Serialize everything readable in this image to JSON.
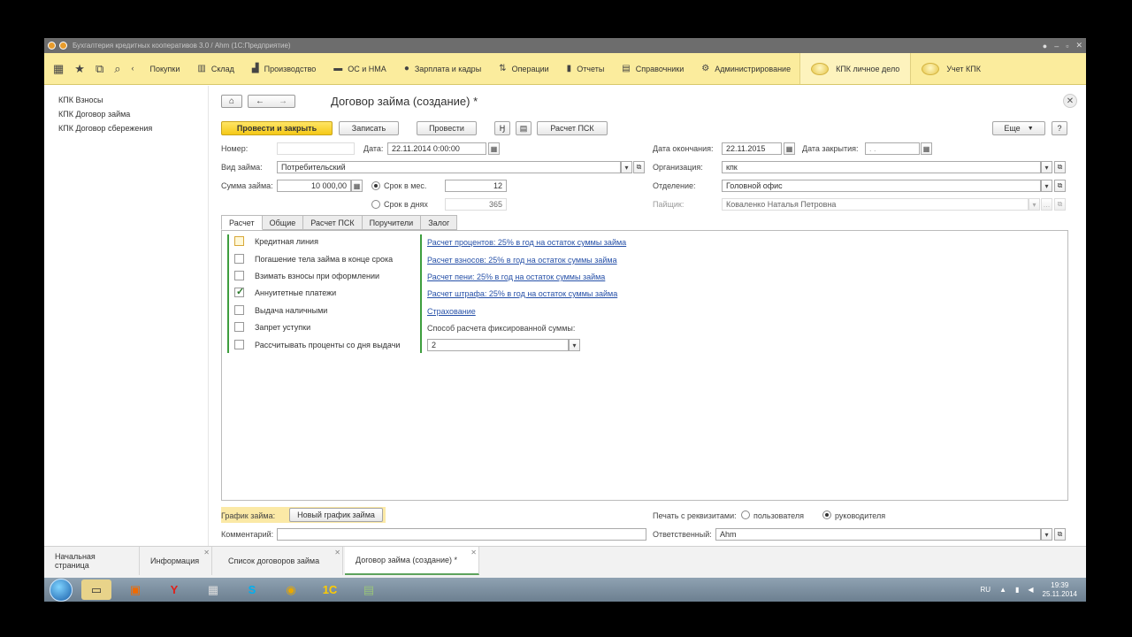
{
  "window": {
    "title": "Бухгалтерия кредитных кооперативов 3.0 / Ahm (1С:Предприятие)"
  },
  "sections": {
    "items": [
      {
        "label": "Покупки",
        "icon": "cart-icon"
      },
      {
        "label": "Склад",
        "icon": "warehouse-icon"
      },
      {
        "label": "Производство",
        "icon": "factory-icon"
      },
      {
        "label": "ОС и НМА",
        "icon": "truck-icon"
      },
      {
        "label": "Зарплата и кадры",
        "icon": "person-icon"
      },
      {
        "label": "Операции",
        "icon": "operations-icon"
      },
      {
        "label": "Отчеты",
        "icon": "chart-icon"
      },
      {
        "label": "Справочники",
        "icon": "book-icon"
      },
      {
        "label": "Администрирование",
        "icon": "gear-icon"
      }
    ],
    "extra": [
      "КПК личное дело",
      "Учет КПК"
    ]
  },
  "left_nav": [
    "КПК Взносы",
    "КПК Договор займа",
    "КПК Договор сбережения"
  ],
  "form": {
    "title": "Договор займа (создание) *",
    "buttons": {
      "post_close": "Провести и закрыть",
      "save": "Записать",
      "post": "Провести",
      "psk": "Расчет ПСК",
      "more": "Еще",
      "help": "?"
    },
    "fields": {
      "number_label": "Номер:",
      "number_value": "",
      "date_label": "Дата:",
      "date_value": "22.11.2014  0:00:00",
      "end_date_label": "Дата окончания:",
      "end_date_value": "22.11.2015",
      "close_date_label": "Дата закрытия:",
      "close_date_value": " .  .",
      "loan_type_label": "Вид займа:",
      "loan_type_value": "Потребительский",
      "org_label": "Организация:",
      "org_value": "кпк",
      "amount_label": "Сумма займа:",
      "amount_value": "10 000,00",
      "term_months_label": "Срок в мес.",
      "term_months_value": "12",
      "term_days_label": "Срок в днях",
      "term_days_value": "365",
      "branch_label": "Отделение:",
      "branch_value": "Головной офис",
      "member_label": "Пайщик:",
      "member_value": "Коваленко Наталья Петровна"
    },
    "tabs": [
      "Расчет",
      "Общие",
      "Расчет ПСК",
      "Поручители",
      "Залог"
    ],
    "active_tab": "Расчет",
    "checkboxes": [
      {
        "label": "Кредитная линия",
        "checked": false
      },
      {
        "label": "Погашение тела займа в конце срока",
        "checked": false
      },
      {
        "label": "Взимать взносы при оформлении",
        "checked": false
      },
      {
        "label": "Аннуитетные платежи",
        "checked": true
      },
      {
        "label": "Выдача наличными",
        "checked": false
      },
      {
        "label": "Запрет уступки",
        "checked": false
      },
      {
        "label": "Рассчитывать проценты со дня выдачи",
        "checked": false
      }
    ],
    "links": [
      "Расчет процентов: 25% в год на остаток суммы займа",
      "Расчет взносов: 25% в год на остаток суммы займа",
      "Расчет пени: 25% в год на остаток суммы займа",
      "Расчет штрафа: 25% в год на остаток суммы займа",
      "Страхование"
    ],
    "fixed_sum_label": "Способ расчета фиксированной суммы:",
    "fixed_sum_value": "2",
    "schedule_label": "График займа:",
    "schedule_button": "Новый график займа",
    "print_label": "Печать с реквизитами:",
    "print_options": [
      "пользователя",
      "руководителя"
    ],
    "print_selected": "руководителя",
    "comment_label": "Комментарий:",
    "comment_value": "",
    "responsible_label": "Ответственный:",
    "responsible_value": "Ahm"
  },
  "open_windows": [
    "Начальная страница",
    "Информация",
    "Список договоров займа",
    "Договор займа (создание) *"
  ],
  "taskbar": {
    "lang": "RU",
    "time": "19:39",
    "date": "25.11.2014"
  }
}
